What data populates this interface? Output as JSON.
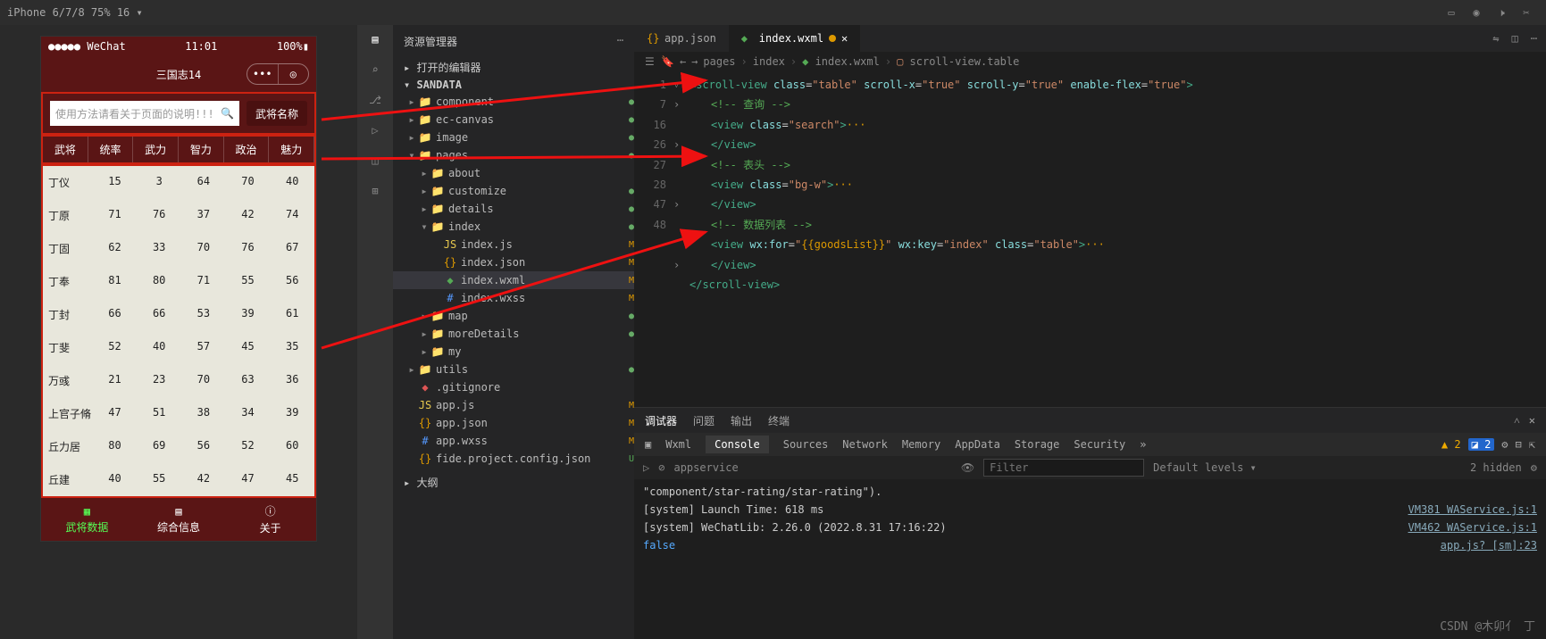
{
  "topbar": {
    "device": "iPhone 6/7/8 75% 16 ▾"
  },
  "sim": {
    "status": {
      "left": "●●●●● WeChat",
      "time": "11:01",
      "right": "100%"
    },
    "appTitle": "三国志14",
    "searchPlaceholder": "使用方法请看关于页面的说明!!!",
    "searchBtn": "武将名称",
    "headers": [
      "武将",
      "统率",
      "武力",
      "智力",
      "政治",
      "魅力"
    ],
    "rows": [
      [
        "丁仪",
        "15",
        "3",
        "64",
        "70",
        "40"
      ],
      [
        "丁原",
        "71",
        "76",
        "37",
        "42",
        "74"
      ],
      [
        "丁固",
        "62",
        "33",
        "70",
        "76",
        "67"
      ],
      [
        "丁奉",
        "81",
        "80",
        "71",
        "55",
        "56"
      ],
      [
        "丁封",
        "66",
        "66",
        "53",
        "39",
        "61"
      ],
      [
        "丁斐",
        "52",
        "40",
        "57",
        "45",
        "35"
      ],
      [
        "万彧",
        "21",
        "23",
        "70",
        "63",
        "36"
      ],
      [
        "上官子脩",
        "47",
        "51",
        "38",
        "34",
        "39"
      ],
      [
        "丘力居",
        "80",
        "69",
        "56",
        "52",
        "60"
      ],
      [
        "丘建",
        "40",
        "55",
        "42",
        "47",
        "45"
      ]
    ],
    "nav": [
      {
        "l": "武将数据"
      },
      {
        "l": "综合信息"
      },
      {
        "l": "关于"
      }
    ]
  },
  "exp": {
    "title": "资源管理器",
    "sec1": "打开的编辑器",
    "root": "SANDATA",
    "tree": [
      {
        "d": 1,
        "t": "folder",
        "n": "component",
        "dot": "g"
      },
      {
        "d": 1,
        "t": "folder",
        "n": "ec-canvas",
        "dot": "g"
      },
      {
        "d": 1,
        "t": "folder",
        "n": "image",
        "dot": "g"
      },
      {
        "d": 1,
        "t": "folder",
        "n": "pages",
        "open": true,
        "dot": "g"
      },
      {
        "d": 2,
        "t": "folder",
        "n": "about"
      },
      {
        "d": 2,
        "t": "folder",
        "n": "customize",
        "dot": "g"
      },
      {
        "d": 2,
        "t": "folder",
        "n": "details",
        "dot": "g"
      },
      {
        "d": 2,
        "t": "folder",
        "n": "index",
        "open": true,
        "dot": "g"
      },
      {
        "d": 3,
        "t": "js",
        "n": "index.js",
        "m": true
      },
      {
        "d": 3,
        "t": "json",
        "n": "index.json",
        "m": true
      },
      {
        "d": 3,
        "t": "wxml",
        "n": "index.wxml",
        "m": true,
        "sel": true
      },
      {
        "d": 3,
        "t": "wxss",
        "n": "index.wxss",
        "m": true
      },
      {
        "d": 2,
        "t": "folder",
        "n": "map",
        "dot": "g"
      },
      {
        "d": 2,
        "t": "folder",
        "n": "moreDetails",
        "dot": "g"
      },
      {
        "d": 2,
        "t": "folder",
        "n": "my"
      },
      {
        "d": 1,
        "t": "folder",
        "n": "utils",
        "dot": "g"
      },
      {
        "d": 1,
        "t": "git",
        "n": ".gitignore"
      },
      {
        "d": 1,
        "t": "js",
        "n": "app.js",
        "m": true
      },
      {
        "d": 1,
        "t": "json",
        "n": "app.json",
        "m": true
      },
      {
        "d": 1,
        "t": "wxss",
        "n": "app.wxss",
        "m": true
      },
      {
        "d": 1,
        "t": "json",
        "n": "fide.project.config.json",
        "u": true
      }
    ],
    "outline": "大纲"
  },
  "ed": {
    "tabs": [
      {
        "ic": "json",
        "l": "app.json"
      },
      {
        "ic": "wxml",
        "l": "index.wxml",
        "act": true,
        "dot": true
      }
    ],
    "crumbs": [
      "pages",
      "index",
      "index.wxml",
      "scroll-view.table"
    ],
    "nums": [
      "1",
      "7",
      "",
      "",
      "16",
      "",
      "",
      "26",
      "27",
      "28",
      "47",
      "48"
    ],
    "lines": [
      {
        "i": 0,
        "h": "<span class='tag'>&lt;scroll-view</span> <span class='at'>class</span>=<span class='st'>\"table\"</span> <span class='at'>scroll-x</span>=<span class='st'>\"true\"</span> <span class='at'>scroll-y</span>=<span class='st'>\"true\"</span> <span class='at'>enable-flex</span>=<span class='st'>\"true\"</span><span class='tag'>&gt;</span>"
      },
      {
        "i": 1,
        "h": "<span class='cm'>&lt;!-- 查询 --&gt;</span>"
      },
      {
        "i": 1,
        "h": "<span class='tag'>&lt;view</span> <span class='at'>class</span>=<span class='st'>\"search\"</span><span class='tag'>&gt;</span><span class='br'>···</span>"
      },
      {
        "i": 1,
        "h": "<span class='tag'>&lt;/view&gt;</span>"
      },
      {
        "i": 1,
        "h": "<span class='cm'>&lt;!-- 表头 --&gt;</span>"
      },
      {
        "i": 1,
        "h": "<span class='tag'>&lt;view</span> <span class='at'>class</span>=<span class='st'>\"bg-w\"</span><span class='tag'>&gt;</span><span class='br'>···</span>"
      },
      {
        "i": 1,
        "h": "<span class='tag'>&lt;/view&gt;</span>"
      },
      {
        "i": 1,
        "h": "<span class='cm'>&lt;!-- 数据列表 --&gt;</span>"
      },
      {
        "i": 1,
        "h": "<span class='tag'>&lt;view</span> <span class='at'>wx:for</span>=<span class='st'>\"</span><span class='br'>{{goodsList}}</span><span class='st'>\"</span> <span class='at'>wx:key</span>=<span class='st'>\"index\"</span> <span class='at'>class</span>=<span class='st'>\"table\"</span><span class='tag'>&gt;</span><span class='br'>···</span>"
      },
      {
        "i": 1,
        "h": "<span class='tag'>&lt;/view&gt;</span>"
      },
      {
        "i": 0,
        "h": "<span class='tag'>&lt;/scroll-view&gt;</span>"
      }
    ]
  },
  "con": {
    "ptabs": [
      "调试器",
      "问题",
      "输出",
      "终端"
    ],
    "dtabs": [
      "Wxml",
      "Console",
      "Sources",
      "Network",
      "Memory",
      "AppData",
      "Storage",
      "Security"
    ],
    "warncount": "2",
    "infocount": "2",
    "ctx": "appservice",
    "filter": "Filter",
    "levels": "Default levels ▾",
    "hidden": "2 hidden",
    "log": [
      {
        "t": "\"component/star-rating/star-rating\").",
        "r": ""
      },
      {
        "t": "[system] Launch Time: 618 ms",
        "r": "VM381 WAService.js:1"
      },
      {
        "t": "[system] WeChatLib: 2.26.0 (2022.8.31 17:16:22)",
        "r": "VM462 WAService.js:1"
      },
      {
        "t": "false",
        "r": "app.js? [sm]:23",
        "blue": true
      }
    ]
  },
  "watermark": "CSDN @木卯亻 丁"
}
